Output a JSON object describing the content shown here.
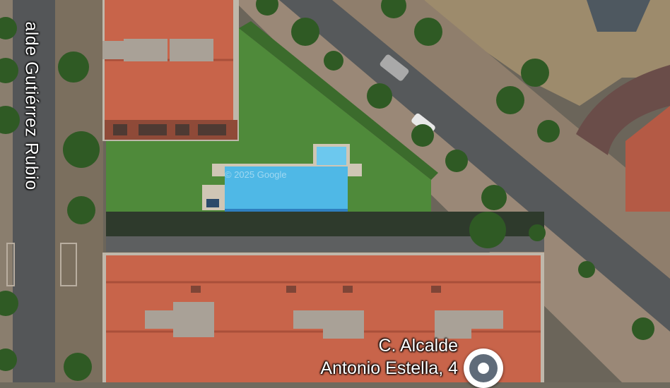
{
  "labels": {
    "street_vertical": "alde Gutiérrez Rubio",
    "place_line1": "C. Alcalde",
    "place_line2": "Antonio Estella, 4",
    "watermark": "© 2025 Google"
  },
  "icons": {
    "place_pin": "location-pin-icon"
  },
  "colors": {
    "roof": "#c8644a",
    "lawn": "#4f8a3a",
    "pool": "#4fb8e6",
    "road": "#5b5e60",
    "pin_ring": "#5f6b79"
  }
}
